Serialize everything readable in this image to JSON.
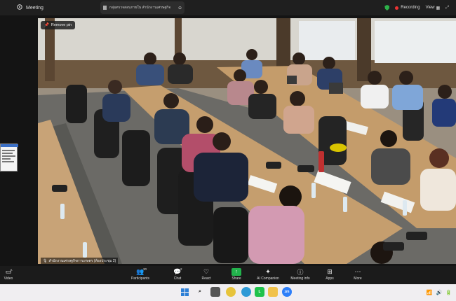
{
  "titlebar": {
    "app_title": "Meeting",
    "tab_title": "กลุ่มตรวจสอบภายใน สำนักงานเศรษฐกิจ",
    "recording_label": "Recording",
    "view_label": "View"
  },
  "video": {
    "remove_pin_label": "Remove pin",
    "caption": "สำนักงานเศรษฐกิจการเกษตร (ห้องประชุม 2)"
  },
  "toolbar": {
    "video_label": "Video",
    "participants_label": "Participants",
    "participants_count": "30",
    "chat_label": "Chat",
    "chat_count": "2",
    "react_label": "React",
    "share_label": "Share",
    "ai_label": "AI Companion",
    "info_label": "Meeting info",
    "apps_label": "Apps",
    "more_label": "More"
  },
  "colors": {
    "share_green": "#22b24c",
    "recording_red": "#e33333",
    "shield_green": "#2db24a"
  }
}
